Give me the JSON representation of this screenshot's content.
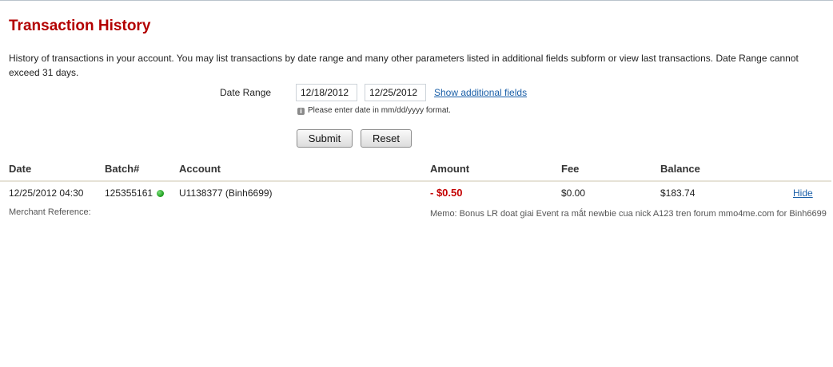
{
  "page": {
    "title": "Transaction History",
    "intro": "History of transactions in your account. You may list transactions by date range and many other parameters listed in additional fields subform or view last transactions. Date Range cannot exceed 31 days."
  },
  "filter": {
    "date_range_label": "Date Range",
    "start_date": "12/18/2012",
    "end_date": "12/25/2012",
    "show_additional_label": "Show additional fields",
    "hint": "Please enter date in mm/dd/yyyy format.",
    "hint_icon": "info-icon",
    "submit_label": "Submit",
    "reset_label": "Reset"
  },
  "table": {
    "headers": {
      "date": "Date",
      "batch": "Batch#",
      "account": "Account",
      "amount": "Amount",
      "fee": "Fee",
      "balance": "Balance"
    },
    "rows": [
      {
        "date": "12/25/2012 04:30",
        "batch": "125355161",
        "status_icon": "green-dot",
        "account": "U1138377 (Binh6699)",
        "amount": "- $0.50",
        "fee": "$0.00",
        "balance": "$183.74",
        "action_label": "Hide",
        "merchant_reference_label": "Merchant Reference:",
        "memo": "Memo: Bonus LR doat giai Event ra mắt newbie cua nick A123 tren forum mmo4me.com for Binh6699"
      }
    ]
  },
  "colors": {
    "title": "#b30000",
    "amount_negative": "#c40000",
    "link": "#1a5fa8",
    "status_ok": "#1a9a1a"
  }
}
